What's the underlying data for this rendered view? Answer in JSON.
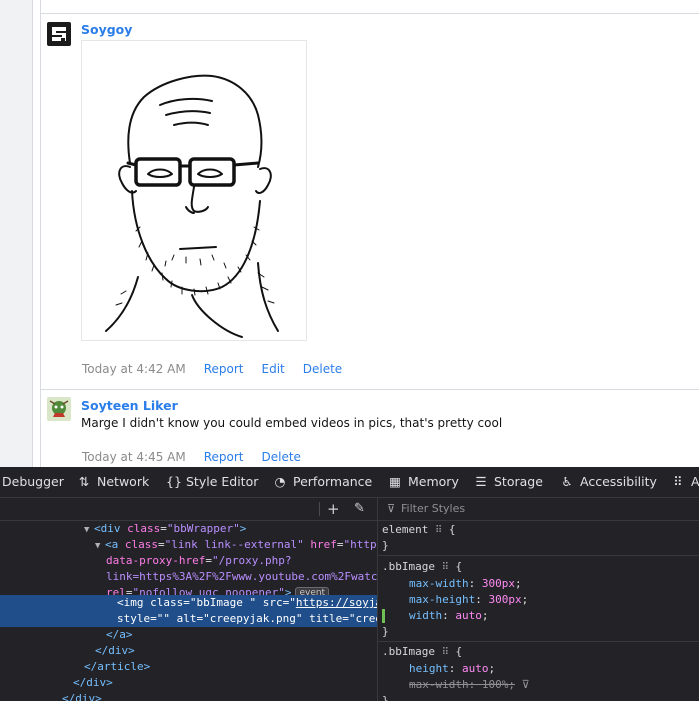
{
  "posts": [
    {
      "author": "Soygoy",
      "image_title": "creepyjak.png",
      "time": "Today at 4:42 AM",
      "actions": [
        "Report",
        "Edit",
        "Delete"
      ]
    },
    {
      "author": "Soyteen Liker",
      "text": "Marge I didn't know you could embed videos in pics, that's pretty cool",
      "time": "Today at 4:45 AM",
      "actions": [
        "Report",
        "Delete"
      ]
    }
  ],
  "devtools": {
    "tabs": [
      {
        "label": "Debugger",
        "icon": "debugger-icon"
      },
      {
        "label": "Network",
        "icon": "network-icon"
      },
      {
        "label": "Style Editor",
        "icon": "braces-icon"
      },
      {
        "label": "Performance",
        "icon": "gauge-icon"
      },
      {
        "label": "Memory",
        "icon": "memory-icon"
      },
      {
        "label": "Storage",
        "icon": "storage-icon"
      },
      {
        "label": "Accessibility",
        "icon": "accessibility-icon"
      },
      {
        "label": "A",
        "icon": "grid-icon"
      }
    ],
    "markup": {
      "l1_tag": "div",
      "l1_attr": "class",
      "l1_val": "\"bbWrapper\"",
      "l2_tag": "a",
      "l2_attr1": "class",
      "l2_val1": "\"link link--external\"",
      "l2_attr2": "href",
      "l2_val2": "\"https",
      "l3_attr": "data-proxy-href",
      "l3_val": "\"/proxy.php?",
      "l4_text": "link=https%3A%2F%2Fwww.youtube.com%2Fwatc",
      "l5_attr": "rel",
      "l5_val": "\"nofollow ugc noopener\"",
      "badge": "event",
      "sel_tag": "img",
      "sel_attr1": "class",
      "sel_val1": "\"bbImage \"",
      "sel_attr2": "src",
      "sel_val2_prefix": "\"",
      "sel_val2": "https://soyja",
      "sel_attr3": "style",
      "sel_val3": "\"\"",
      "sel_attr4": "alt",
      "sel_val4": "\"creepyjak.png\"",
      "sel_attr5": "title",
      "sel_val5": "\"cree",
      "close_a": "a",
      "close_div": "div",
      "close_article": "article",
      "close_div2": "div",
      "close_div3": "div"
    },
    "rules": {
      "filter_placeholder": "Filter Styles",
      "r1_selector": "element",
      "r2_selector": ".bbImage",
      "r2_props": [
        {
          "name": "max-width",
          "value": "300px"
        },
        {
          "name": "max-height",
          "value": "300px"
        },
        {
          "name": "width",
          "value": "auto"
        }
      ],
      "r3_selector": ".bbImage",
      "r3_props": [
        {
          "name": "height",
          "value": "auto"
        },
        {
          "name": "max-width",
          "value": "100%"
        }
      ]
    }
  }
}
